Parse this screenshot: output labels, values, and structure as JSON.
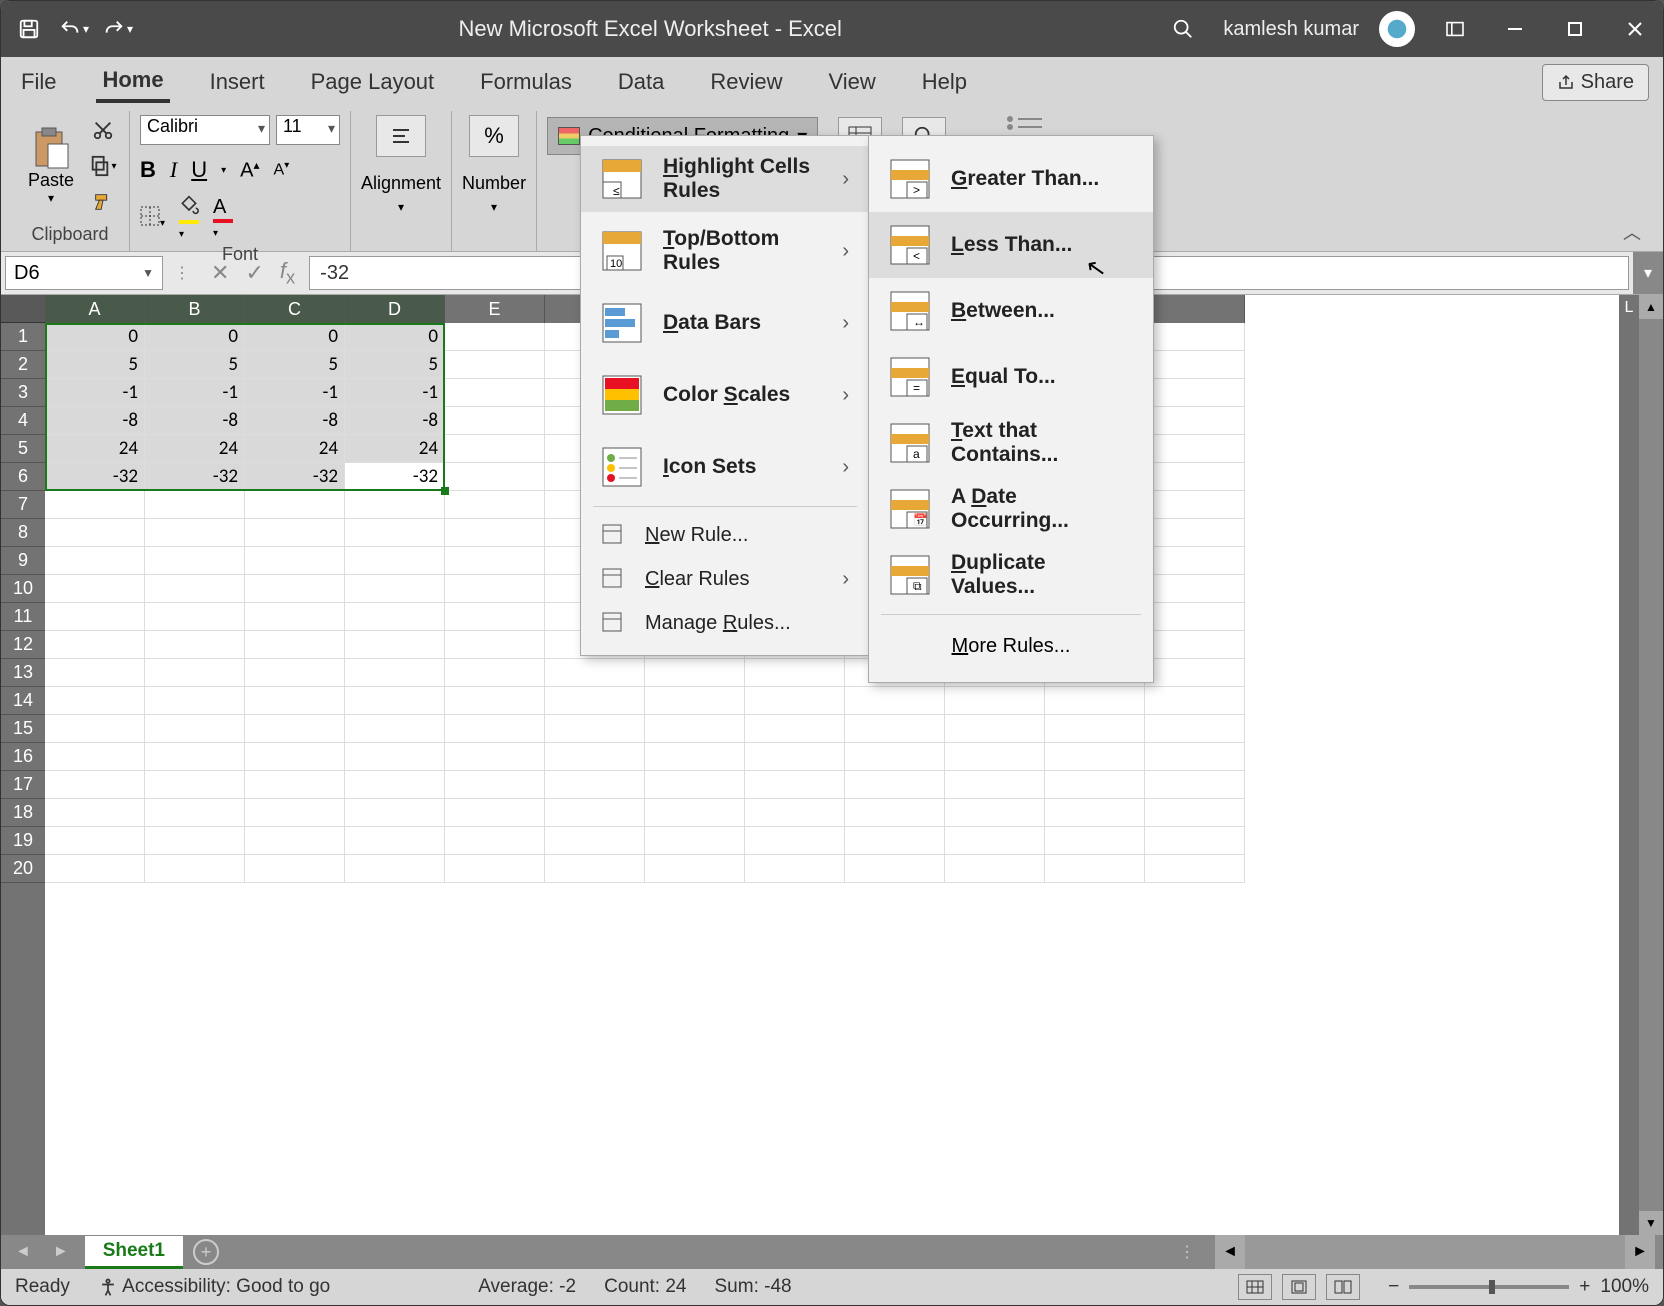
{
  "titlebar": {
    "title": "New Microsoft Excel Worksheet  -  Excel",
    "user": "kamlesh kumar"
  },
  "tabs": [
    "File",
    "Home",
    "Insert",
    "Page Layout",
    "Formulas",
    "Data",
    "Review",
    "View",
    "Help"
  ],
  "active_tab": "Home",
  "share_label": "Share",
  "ribbon": {
    "clipboard_label": "Clipboard",
    "paste_label": "Paste",
    "font_label": "Font",
    "font_name": "Calibri",
    "font_size": "11",
    "alignment_label": "Alignment",
    "number_label": "Number",
    "cf_label": "Conditional Formatting"
  },
  "namebox": "D6",
  "formula": "-32",
  "columns": [
    "A",
    "B",
    "C",
    "D",
    "E"
  ],
  "last_col": "L",
  "rows": [
    1,
    2,
    3,
    4,
    5,
    6,
    7,
    8,
    9,
    10,
    11,
    12,
    13,
    14,
    15,
    16,
    17,
    18,
    19,
    20
  ],
  "cells": [
    [
      "0",
      "0",
      "0",
      "0"
    ],
    [
      "5",
      "5",
      "5",
      "5"
    ],
    [
      "-1",
      "-1",
      "-1",
      "-1"
    ],
    [
      "-8",
      "-8",
      "-8",
      "-8"
    ],
    [
      "24",
      "24",
      "24",
      "24"
    ],
    [
      "-32",
      "-32",
      "-32",
      "-32"
    ]
  ],
  "active_cell": {
    "row": 6,
    "col": 4
  },
  "sheet": {
    "name": "Sheet1"
  },
  "status": {
    "ready": "Ready",
    "access": "Accessibility: Good to go",
    "avg": "Average: -2",
    "count": "Count: 24",
    "sum": "Sum: -48",
    "zoom": "100%"
  },
  "menu1": [
    {
      "label": "Highlight Cells Rules",
      "sub": true,
      "u": 0,
      "icon": "hcr"
    },
    {
      "label": "Top/Bottom Rules",
      "sub": true,
      "u": 0,
      "icon": "tbr"
    },
    {
      "label": "Data Bars",
      "sub": true,
      "u": 0,
      "icon": "db"
    },
    {
      "label": "Color Scales",
      "sub": true,
      "u": 6,
      "icon": "cs"
    },
    {
      "label": "Icon Sets",
      "sub": true,
      "u": 0,
      "icon": "is"
    }
  ],
  "menu1b": [
    {
      "label": "New Rule...",
      "u": 0
    },
    {
      "label": "Clear Rules",
      "u": 0,
      "sub": true
    },
    {
      "label": "Manage Rules...",
      "u": 7
    }
  ],
  "menu2": [
    {
      "label": "Greater Than...",
      "u": 0
    },
    {
      "label": "Less Than...",
      "u": 0,
      "hover": true
    },
    {
      "label": "Between...",
      "u": 0
    },
    {
      "label": "Equal To...",
      "u": 0
    },
    {
      "label": "Text that Contains...",
      "u": 0
    },
    {
      "label": "A Date Occurring...",
      "u": 2
    },
    {
      "label": "Duplicate Values...",
      "u": 0
    }
  ],
  "menu2_more": "More Rules..."
}
